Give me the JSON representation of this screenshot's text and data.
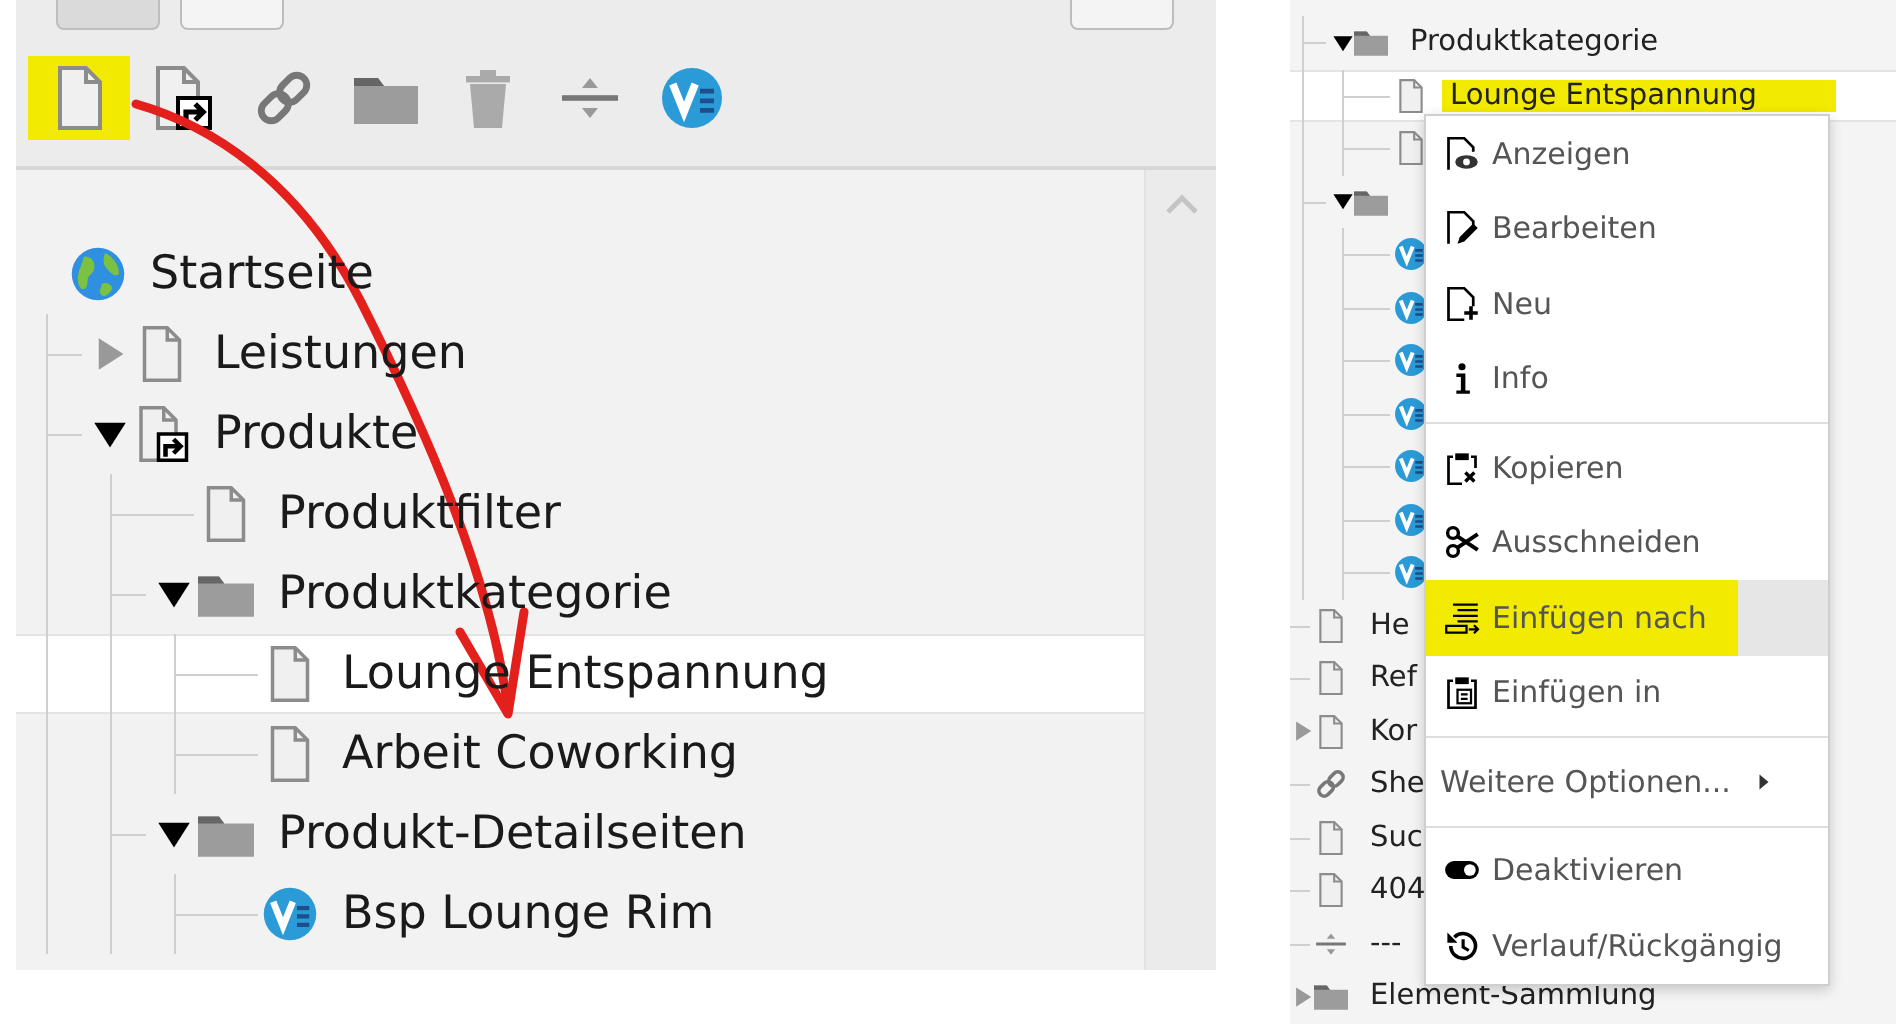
{
  "toolbar": {
    "items": [
      {
        "kind": "page",
        "highlighted": true
      },
      {
        "kind": "shortcut",
        "highlighted": false
      },
      {
        "kind": "link",
        "highlighted": false
      },
      {
        "kind": "folder",
        "highlighted": false
      },
      {
        "kind": "trash",
        "highlighted": false
      },
      {
        "kind": "divider",
        "highlighted": false
      },
      {
        "kind": "v",
        "highlighted": false
      }
    ]
  },
  "page_tree": {
    "items": [
      {
        "label": "Startseite",
        "kind": "globe",
        "selected": false,
        "children": [
          {
            "label": "Leistungen",
            "kind": "page",
            "expanded": false,
            "selected": false
          },
          {
            "label": "Produkte",
            "kind": "shortcut",
            "expanded": true,
            "selected": false,
            "children": [
              {
                "label": "Produktfilter",
                "kind": "page",
                "selected": false
              },
              {
                "label": "Produktkategorie",
                "kind": "folder",
                "expanded": true,
                "selected": false,
                "children": [
                  {
                    "label": "Lounge Entspannung",
                    "kind": "page",
                    "selected": true
                  },
                  {
                    "label": "Arbeit Coworking",
                    "kind": "page",
                    "selected": false
                  }
                ]
              },
              {
                "label": "Produkt-Detailseiten",
                "kind": "folder",
                "expanded": true,
                "selected": false,
                "children": [
                  {
                    "label": "Bsp Lounge Rim",
                    "kind": "v",
                    "selected": false
                  }
                ]
              }
            ]
          }
        ]
      }
    ]
  },
  "page_tree_2": {
    "items": [
      {
        "children": [
          {
            "label": "Produktkategorie",
            "kind": "folder",
            "expanded": true,
            "selected": false,
            "children": [
              {
                "label": "Lounge Entspannung",
                "kind": "page",
                "selected": true,
                "highlighted": true
              },
              {
                "kind": "page",
                "selected": false
              }
            ]
          },
          {
            "kind": "folder",
            "expanded": true,
            "selected": false,
            "children": [
              {
                "kind": "v",
                "selected": false
              },
              {
                "kind": "v",
                "selected": false
              },
              {
                "kind": "v",
                "selected": false
              },
              {
                "kind": "v",
                "selected": false
              },
              {
                "kind": "v",
                "selected": false
              },
              {
                "kind": "v",
                "selected": false
              },
              {
                "kind": "v",
                "selected": false
              }
            ]
          }
        ]
      },
      {
        "label": "He",
        "kind": "page",
        "selected": false
      },
      {
        "label": "Ref",
        "kind": "page",
        "selected": false
      },
      {
        "label": "Kor",
        "kind": "page",
        "expanded": false,
        "selected": false
      },
      {
        "label": "She",
        "kind": "link",
        "selected": false
      },
      {
        "label": "Suc",
        "kind": "page",
        "selected": false
      },
      {
        "label": "404",
        "kind": "page",
        "selected": false
      },
      {
        "label": "---",
        "kind": "divider",
        "selected": false
      },
      {
        "label": "Element-Sammlung",
        "kind": "folder",
        "expanded": false,
        "selected": false
      }
    ]
  },
  "context_menu": {
    "groups": [
      [
        {
          "label": "Anzeigen",
          "kind": "view",
          "selected": false
        },
        {
          "label": "Bearbeiten",
          "kind": "edit",
          "selected": false
        },
        {
          "label": "Neu",
          "kind": "new",
          "selected": false
        },
        {
          "label": "Info",
          "kind": "info",
          "selected": false
        }
      ],
      [
        {
          "label": "Kopieren",
          "kind": "copy",
          "selected": false
        },
        {
          "label": "Ausschneiden",
          "kind": "cut",
          "selected": false
        },
        {
          "label": "Einfügen nach",
          "kind": "paste_after",
          "selected": true,
          "highlighted": true
        },
        {
          "label": "Einfügen in",
          "kind": "paste_into",
          "selected": false
        }
      ],
      [
        {
          "label": "Weitere Optionen...",
          "kind": "submenu",
          "selected": false
        }
      ],
      [
        {
          "label": "Deaktivieren",
          "kind": "disable",
          "selected": false
        },
        {
          "label": "Verlauf/Rückgängig",
          "kind": "history",
          "selected": false
        }
      ]
    ]
  }
}
